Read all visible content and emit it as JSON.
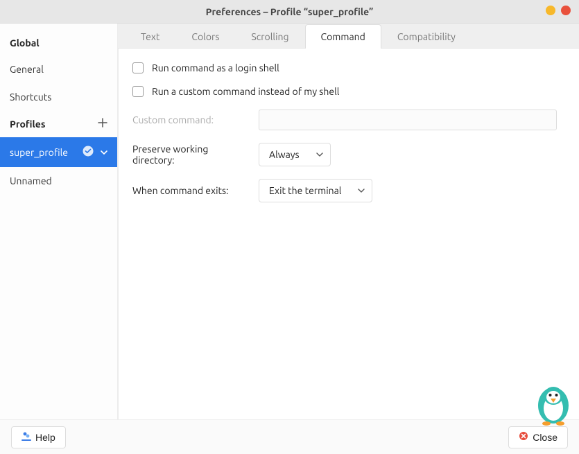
{
  "titlebar": {
    "title": "Preferences – Profile “super_profile”"
  },
  "sidebar": {
    "global_header": "Global",
    "items_global": [
      {
        "label": "General"
      },
      {
        "label": "Shortcuts"
      }
    ],
    "profiles_header": "Profiles",
    "items_profiles": [
      {
        "label": "super_profile",
        "selected": true
      },
      {
        "label": "Unnamed",
        "selected": false
      }
    ]
  },
  "tabs": [
    {
      "label": "Text",
      "active": false
    },
    {
      "label": "Colors",
      "active": false
    },
    {
      "label": "Scrolling",
      "active": false
    },
    {
      "label": "Command",
      "active": true
    },
    {
      "label": "Compatibility",
      "active": false
    }
  ],
  "command": {
    "login_shell_label": "Run command as a login shell",
    "custom_cmd_label": "Run a custom command instead of my shell",
    "custom_cmd_field_label": "Custom command:",
    "custom_cmd_value": "",
    "preserve_dir_label": "Preserve working directory:",
    "preserve_dir_value": "Always",
    "when_exits_label": "When command exits:",
    "when_exits_value": "Exit the terminal"
  },
  "footer": {
    "help_label": "Help",
    "close_label": "Close"
  }
}
